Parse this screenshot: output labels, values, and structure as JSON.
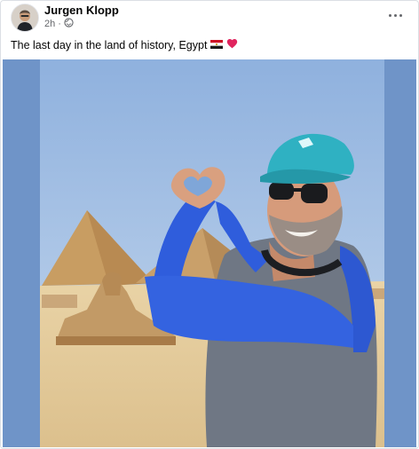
{
  "post": {
    "author": "Jurgen Klopp",
    "time": "2h",
    "privacy_icon": "globe-icon",
    "caption": "The last day in the land of history, Egypt",
    "caption_emojis": [
      "egypt-flag-icon",
      "red-heart-icon"
    ],
    "more_icon": "more-options-icon"
  },
  "photo": {
    "scene": "photo-egypt-pyramids-heart-hands"
  },
  "colors": {
    "frame_blue": "#6f94c8",
    "sky": "#a9c6e7",
    "sand": "#e6cfa1",
    "cap": "#2fb1c2",
    "jacket_blue": "#2f5bd6",
    "vest_gray": "#6f7784"
  }
}
